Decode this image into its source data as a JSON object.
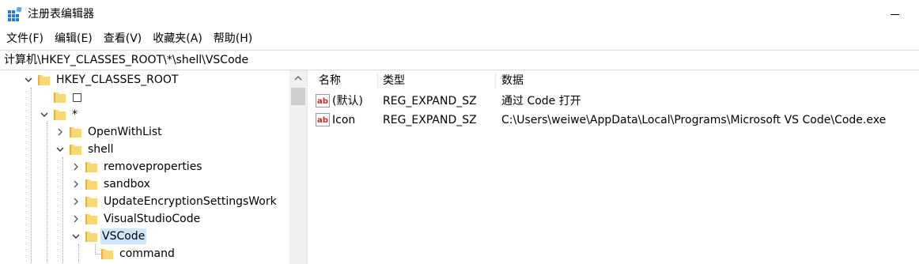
{
  "window": {
    "title": "注册表编辑器"
  },
  "menu": [
    "文件(F)",
    "编辑(E)",
    "查看(V)",
    "收藏夹(A)",
    "帮助(H)"
  ],
  "address": {
    "path": "计算机\\HKEY_CLASSES_ROOT\\*\\shell\\VSCode"
  },
  "tree": {
    "items": [
      {
        "label": "HKEY_CLASSES_ROOT",
        "expanded": true
      },
      {
        "label": "□"
      },
      {
        "label": "*",
        "expanded": true
      },
      {
        "label": "OpenWithList",
        "expanded": false
      },
      {
        "label": "shell",
        "expanded": true
      },
      {
        "label": "removeproperties",
        "expanded": false
      },
      {
        "label": "sandbox",
        "expanded": false
      },
      {
        "label": "UpdateEncryptionSettingsWork",
        "expanded": false
      },
      {
        "label": "VisualStudioCode",
        "expanded": false
      },
      {
        "label": "VSCode",
        "expanded": true,
        "selected": true
      },
      {
        "label": "command"
      }
    ]
  },
  "values": {
    "headers": {
      "name": "名称",
      "type": "类型",
      "data": "数据"
    },
    "rows": [
      {
        "name": "(默认)",
        "type": "REG_EXPAND_SZ",
        "data": "通过 Code 打开"
      },
      {
        "name": "Icon",
        "type": "REG_EXPAND_SZ",
        "data": "C:\\Users\\weiwe\\AppData\\Local\\Programs\\Microsoft VS Code\\Code.exe"
      }
    ]
  },
  "colors": {
    "selection": "#cce8ff",
    "folder": "#f8d775",
    "icon_blue": "#1e78d7",
    "ab_red": "#c42b1c"
  }
}
